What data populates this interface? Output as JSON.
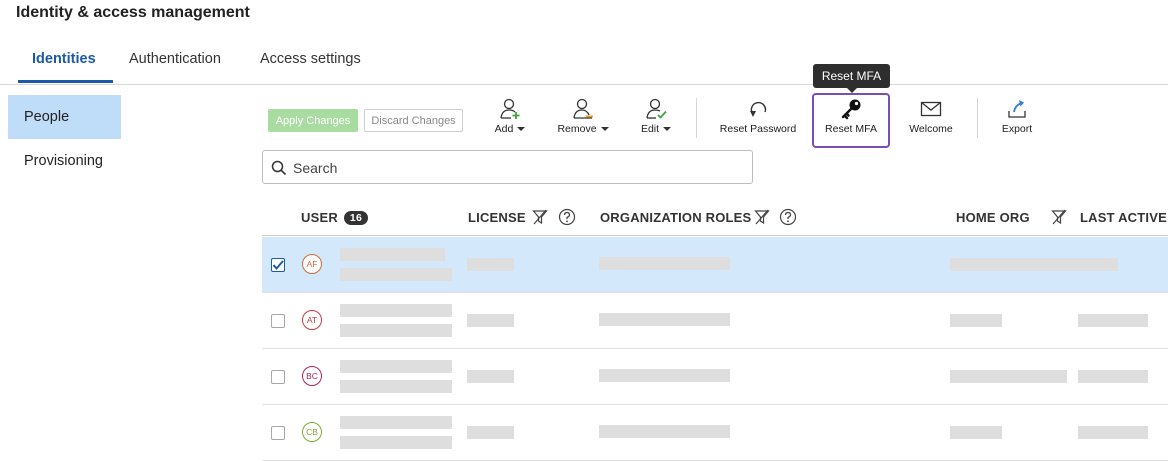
{
  "page": {
    "title": "Identity & access management"
  },
  "tabs": [
    {
      "label": "Identities",
      "active": true
    },
    {
      "label": "Authentication",
      "active": false
    },
    {
      "label": "Access settings",
      "active": false
    }
  ],
  "sidebar": {
    "items": [
      {
        "label": "People",
        "active": true
      },
      {
        "label": "Provisioning",
        "active": false
      }
    ]
  },
  "toolbar": {
    "apply_label": "Apply Changes",
    "discard_label": "Discard Changes",
    "add_label": "Add",
    "remove_label": "Remove",
    "edit_label": "Edit",
    "reset_password_label": "Reset Password",
    "reset_mfa_label": "Reset MFA",
    "welcome_label": "Welcome",
    "export_label": "Export",
    "tooltip": "Reset MFA"
  },
  "search": {
    "placeholder": "Search",
    "value": ""
  },
  "table": {
    "columns": {
      "user": "USER",
      "user_count": "16",
      "license": "LICENSE",
      "org_roles": "ORGANIZATION ROLES",
      "home_org": "HOME ORG",
      "last_active": "LAST ACTIVE"
    },
    "rows": [
      {
        "initials": "AF",
        "selected": true,
        "avatar_color": "#d4683f"
      },
      {
        "initials": "AT",
        "selected": false,
        "avatar_color": "#c8384a"
      },
      {
        "initials": "BC",
        "selected": false,
        "avatar_color": "#a8285f"
      },
      {
        "initials": "CB",
        "selected": false,
        "avatar_color": "#7fa83a"
      }
    ]
  },
  "colors": {
    "accent": "#1b5aa6",
    "selected_row": "#d3e8fb",
    "sidebar_active": "#bfdcf9",
    "highlight_border": "#7a4fb3"
  }
}
